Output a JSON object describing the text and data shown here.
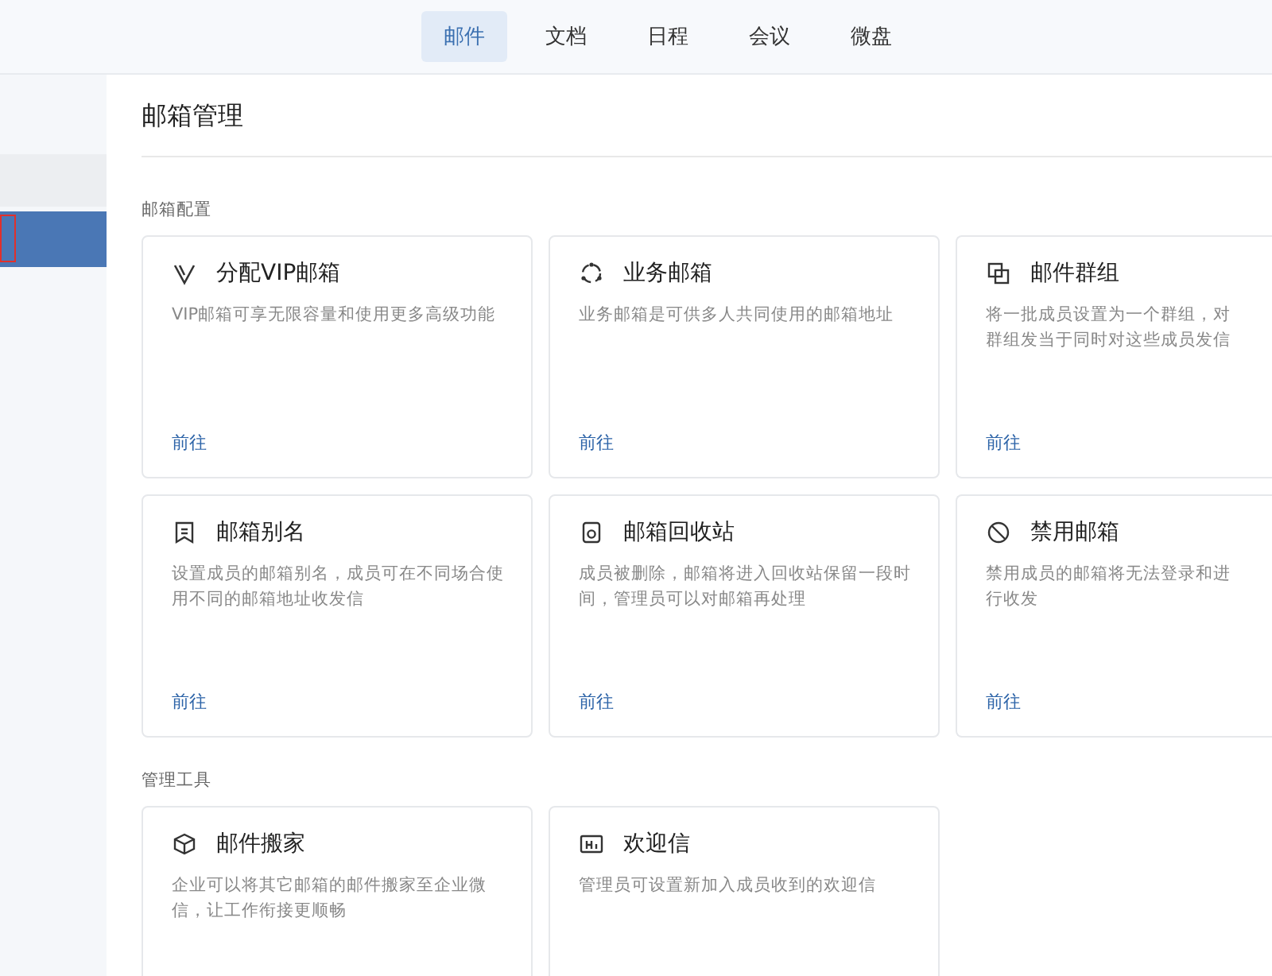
{
  "tabs": [
    {
      "label": "邮件",
      "selected": true
    },
    {
      "label": "文档",
      "selected": false
    },
    {
      "label": "日程",
      "selected": false
    },
    {
      "label": "会议",
      "selected": false
    },
    {
      "label": "微盘",
      "selected": false
    }
  ],
  "sidebar": {
    "items": [
      {
        "selected": false
      },
      {
        "selected": true
      }
    ]
  },
  "page_title": "邮箱管理",
  "sections": [
    {
      "title": "邮箱配置",
      "cards": [
        {
          "title": "分配VIP邮箱",
          "description": "VIP邮箱可享无限容量和使用更多高级功能",
          "link": "前往"
        },
        {
          "title": "业务邮箱",
          "description": "业务邮箱是可供多人共同使用的邮箱地址",
          "link": "前往"
        },
        {
          "title": "邮件群组",
          "description": "将一批成员设置为一个群组，对群组发当于同时对这些成员发信",
          "link": "前往"
        },
        {
          "title": "邮箱别名",
          "description": "设置成员的邮箱别名，成员可在不同场合使用不同的邮箱地址收发信",
          "link": "前往"
        },
        {
          "title": "邮箱回收站",
          "description": "成员被删除，邮箱将进入回收站保留一段时间，管理员可以对邮箱再处理",
          "link": "前往"
        },
        {
          "title": "禁用邮箱",
          "description": "禁用成员的邮箱将无法登录和进行收发",
          "link": "前往"
        }
      ]
    },
    {
      "title": "管理工具",
      "cards": [
        {
          "title": "邮件搬家",
          "description": "企业可以将其它邮箱的邮件搬家至企业微信，让工作衔接更顺畅"
        },
        {
          "title": "欢迎信",
          "description": "管理员可设置新加入成员收到的欢迎信"
        }
      ]
    }
  ]
}
